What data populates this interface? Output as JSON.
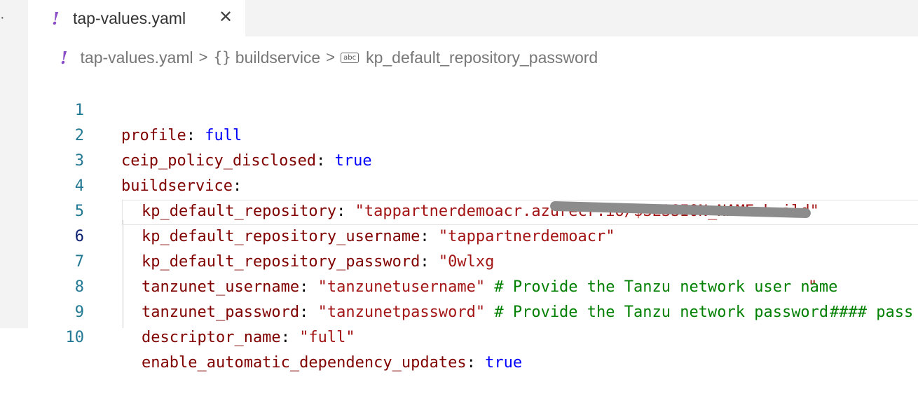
{
  "tab": {
    "icon_glyph": "!",
    "title": "tap-values.yaml",
    "close_glyph": "✕"
  },
  "breadcrumb": {
    "file": "tap-values.yaml",
    "sep": ">",
    "braces": "{}",
    "object": "buildservice",
    "abc": "abc",
    "key": "kp_default_repository_password"
  },
  "lines": [
    {
      "num": "1",
      "key": "profile",
      "colon": ": ",
      "value": "full",
      "comment": ""
    },
    {
      "num": "2",
      "key": "ceip_policy_disclosed",
      "colon": ": ",
      "value": "true",
      "comment": ""
    },
    {
      "num": "3",
      "key": "buildservice",
      "colon": ":",
      "value": "",
      "comment": ""
    },
    {
      "num": "4",
      "key": "kp_default_repository",
      "colon": ": ",
      "value": "\"tappartnerdemoacr.azurecr.io/$SESSION_NAME-build\"",
      "comment": ""
    },
    {
      "num": "5",
      "key": "kp_default_repository_username",
      "colon": ": ",
      "value": "\"tappartnerdemoacr\"",
      "comment": ""
    },
    {
      "num": "6",
      "key": "kp_default_repository_password",
      "colon": ": ",
      "value": "\"0wlxg",
      "value_tail": "\"",
      "comment": "#### pass"
    },
    {
      "num": "7",
      "key": "tanzunet_username",
      "colon": ": ",
      "value": "\"tanzunetusername\"",
      "comment": "# Provide the Tanzu network user name"
    },
    {
      "num": "8",
      "key": "tanzunet_password",
      "colon": ": ",
      "value": "\"tanzunetpassword\"",
      "comment": "# Provide the Tanzu network password"
    },
    {
      "num": "9",
      "key": "descriptor_name",
      "colon": ": ",
      "value": "\"full\"",
      "comment": ""
    },
    {
      "num": "10",
      "key": "enable_automatic_dependency_updates",
      "colon": ": ",
      "value": "true",
      "comment": ""
    }
  ],
  "colors": {
    "key": "#800000",
    "string": "#a31515",
    "keyword": "#0000ff",
    "comment": "#008000",
    "line_number": "#237893",
    "yaml_icon": "#8a4fc7"
  }
}
